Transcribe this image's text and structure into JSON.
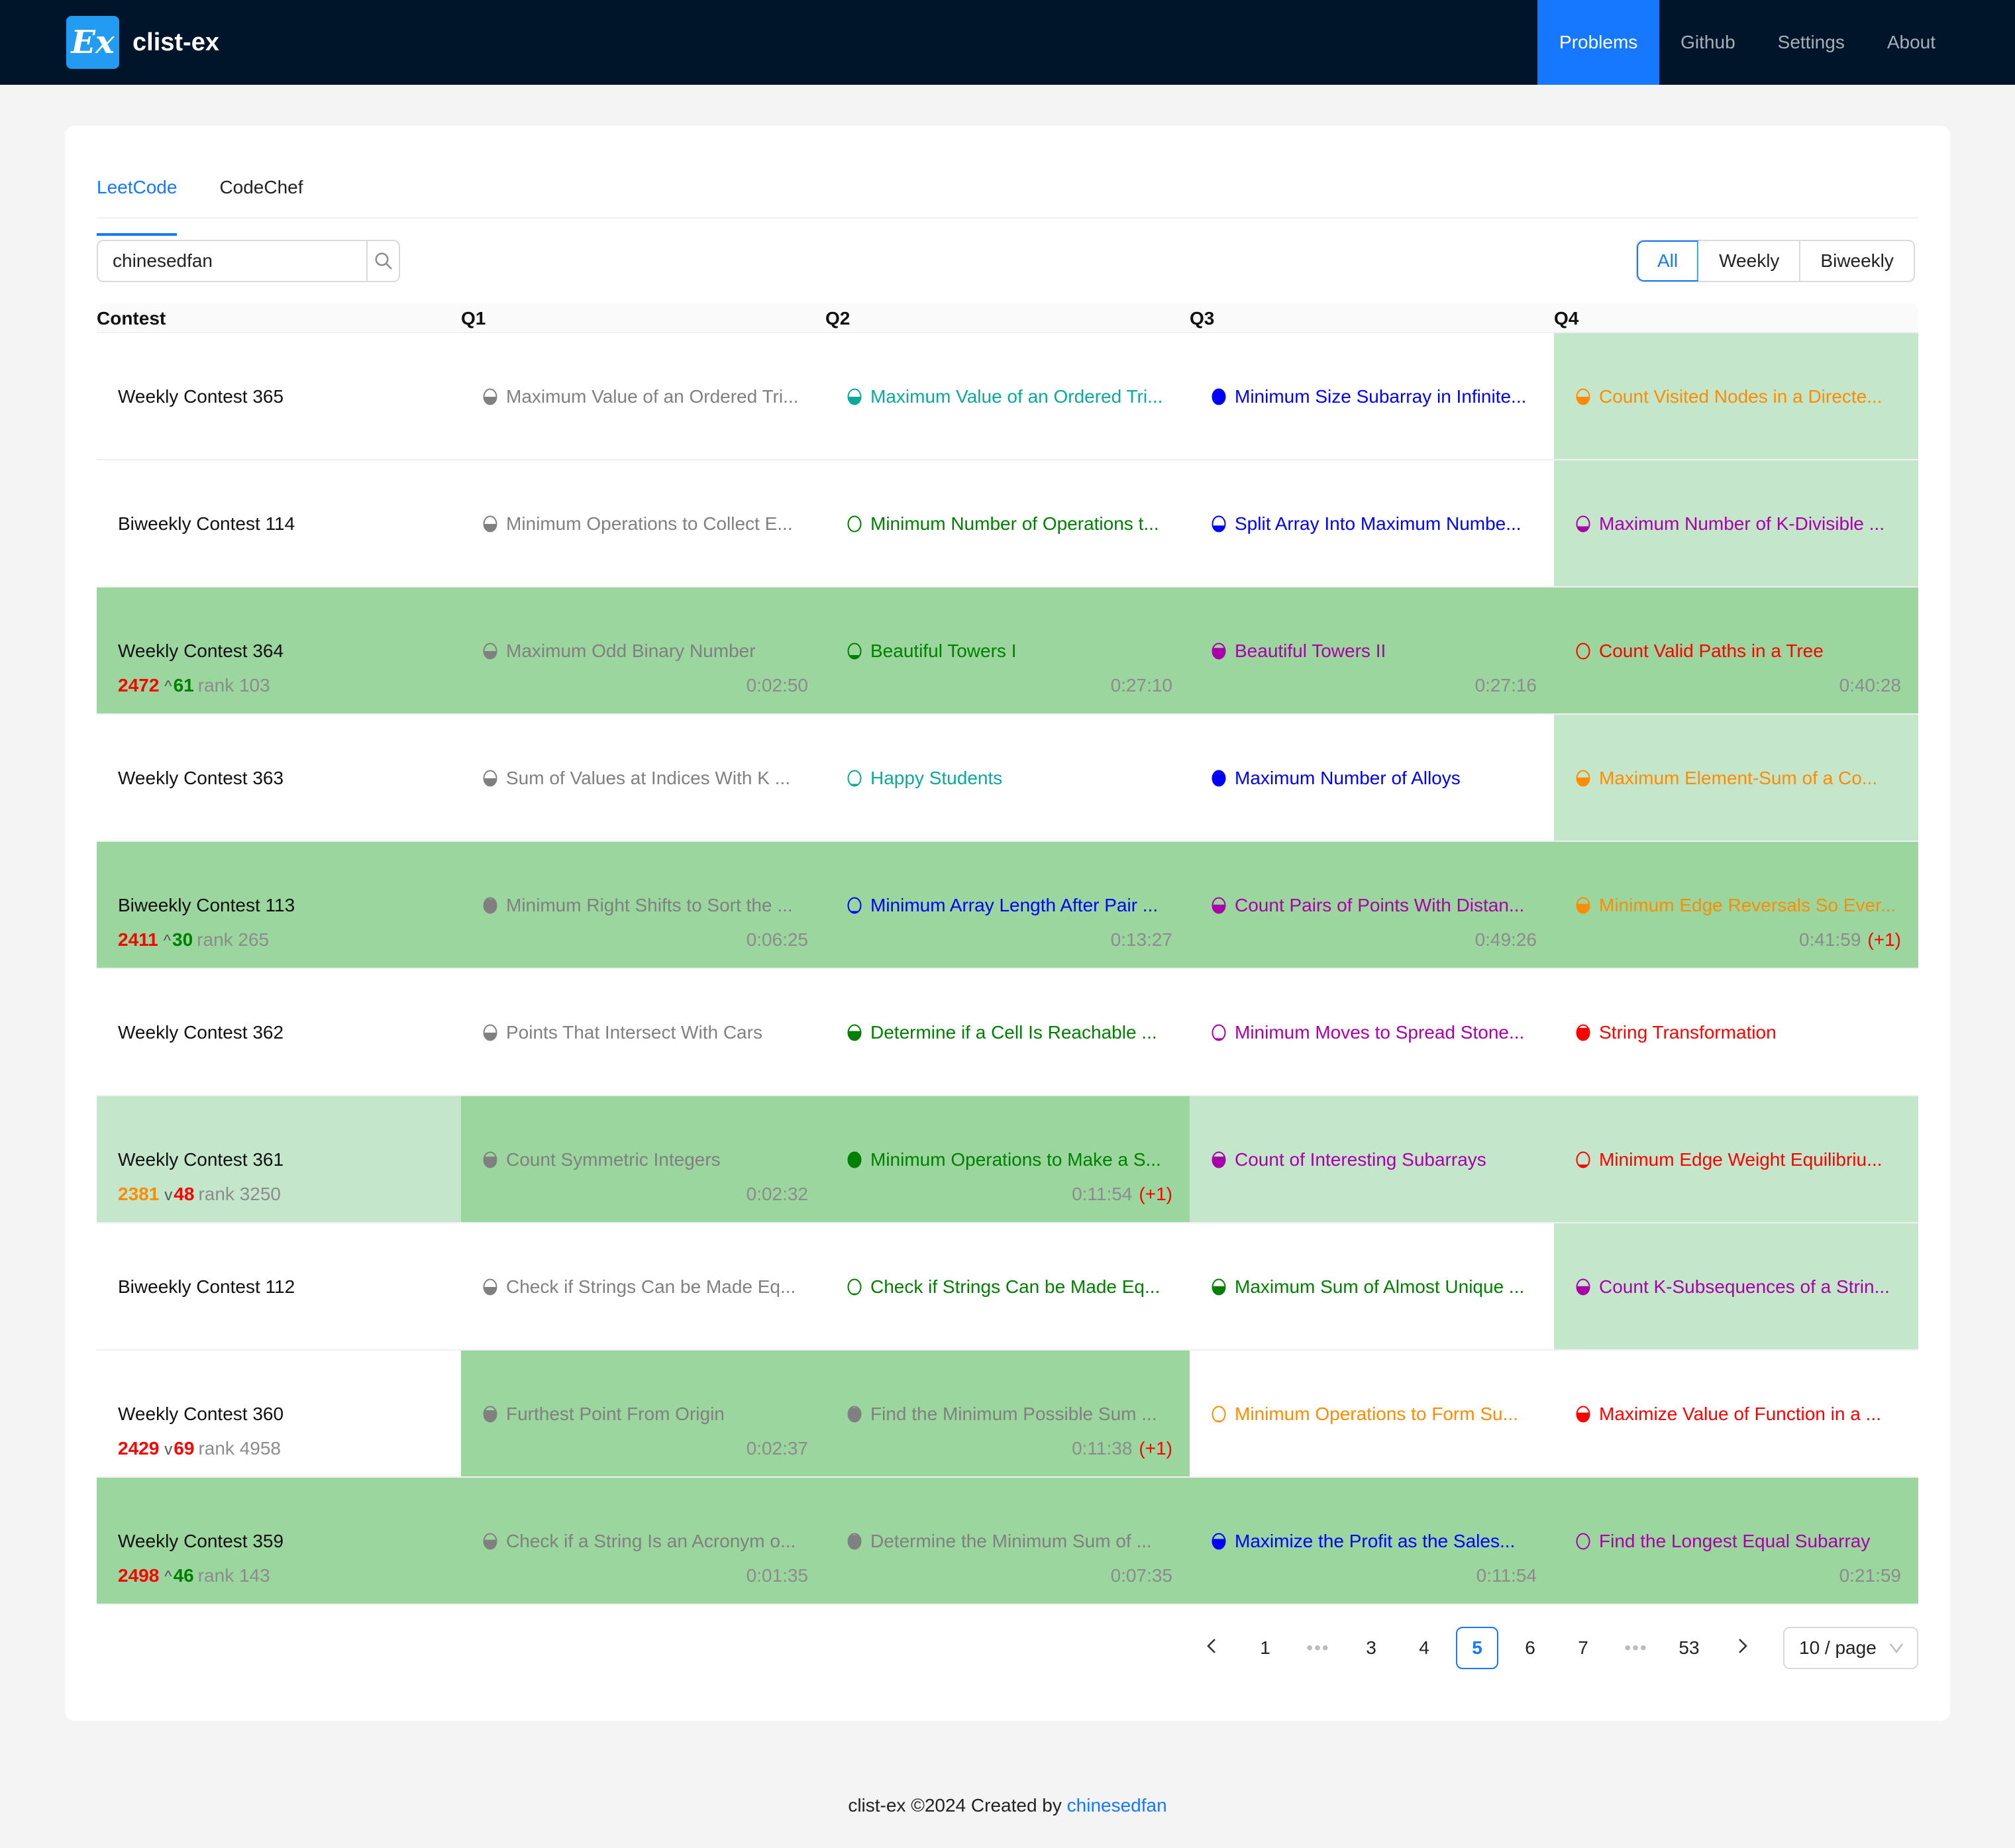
{
  "app": {
    "logo_text": "Ex",
    "brand": "clist-ex",
    "nav": [
      {
        "label": "Problems",
        "active": true
      },
      {
        "label": "Github",
        "active": false
      },
      {
        "label": "Settings",
        "active": false
      },
      {
        "label": "About",
        "active": false
      }
    ]
  },
  "tabs": [
    {
      "label": "LeetCode",
      "active": true
    },
    {
      "label": "CodeChef",
      "active": false
    }
  ],
  "search": {
    "value": "chinesedfan",
    "icon": "search-icon"
  },
  "filter": {
    "options": [
      "All",
      "Weekly",
      "Biweekly"
    ],
    "selected": "All"
  },
  "table": {
    "headers": [
      "Contest",
      "Q1",
      "Q2",
      "Q3",
      "Q4"
    ],
    "colors": {
      "row_highlight": "#9bd69e",
      "cell_solved_upsolve": "#c4e6cb",
      "gray": "#808080",
      "teal": "#0aa99a",
      "green": "#008000",
      "blue": "#0000ff",
      "purple": "#aa00aa",
      "orange": "#ff8c00",
      "red": "#ff0000"
    },
    "rows": [
      {
        "contest": "Weekly Contest 365",
        "row_bg": null,
        "problems": [
          {
            "title": "Maximum Value of an Ordered Tri...",
            "color": "gray",
            "fill": 0.5,
            "bg": null
          },
          {
            "title": "Maximum Value of an Ordered Tri...",
            "color": "teal",
            "fill": 0.5,
            "bg": null
          },
          {
            "title": "Minimum Size Subarray in Infinite...",
            "color": "blue",
            "fill": 0.95,
            "bg": null
          },
          {
            "title": "Count Visited Nodes in a Directe...",
            "color": "orange",
            "fill": 0.5,
            "bg": "light"
          }
        ]
      },
      {
        "contest": "Biweekly Contest 114",
        "row_bg": null,
        "problems": [
          {
            "title": "Minimum Operations to Collect E...",
            "color": "gray",
            "fill": 0.5,
            "bg": null
          },
          {
            "title": "Minimum Number of Operations t...",
            "color": "green",
            "fill": 0.05,
            "bg": null
          },
          {
            "title": "Split Array Into Maximum Numbe...",
            "color": "blue",
            "fill": 0.4,
            "bg": null
          },
          {
            "title": "Maximum Number of K-Divisible ...",
            "color": "purple",
            "fill": 0.35,
            "bg": "light"
          }
        ]
      },
      {
        "contest": "Weekly Contest 364",
        "row_bg": "dark",
        "rating": {
          "value": "2472",
          "color": "red",
          "direction": "up",
          "delta": "61",
          "delta_color": "green",
          "rank": "rank 103"
        },
        "problems": [
          {
            "title": "Maximum Odd Binary Number",
            "color": "gray",
            "fill": 0.5,
            "time": "0:02:50"
          },
          {
            "title": "Beautiful Towers I",
            "color": "green",
            "fill": 0.25,
            "time": "0:27:10"
          },
          {
            "title": "Beautiful Towers II",
            "color": "purple",
            "fill": 0.7,
            "time": "0:27:16"
          },
          {
            "title": "Count Valid Paths in a Tree",
            "color": "red",
            "fill": 0.05,
            "time": "0:40:28"
          }
        ]
      },
      {
        "contest": "Weekly Contest 363",
        "row_bg": null,
        "problems": [
          {
            "title": "Sum of Values at Indices With K ...",
            "color": "gray",
            "fill": 0.5,
            "bg": null
          },
          {
            "title": "Happy Students",
            "color": "teal",
            "fill": 0.15,
            "bg": null
          },
          {
            "title": "Maximum Number of Alloys",
            "color": "blue",
            "fill": 0.95,
            "bg": null
          },
          {
            "title": "Maximum Element-Sum of a Co...",
            "color": "orange",
            "fill": 0.55,
            "bg": "light"
          }
        ]
      },
      {
        "contest": "Biweekly Contest 113",
        "row_bg": "dark",
        "rating": {
          "value": "2411",
          "color": "red",
          "direction": "up",
          "delta": "30",
          "delta_color": "green",
          "rank": "rank 265"
        },
        "problems": [
          {
            "title": "Minimum Right Shifts to Sort the ...",
            "color": "gray",
            "fill": 0.9,
            "time": "0:06:25"
          },
          {
            "title": "Minimum Array Length After Pair ...",
            "color": "blue",
            "fill": 0.15,
            "time": "0:13:27"
          },
          {
            "title": "Count Pairs of Points With Distan...",
            "color": "purple",
            "fill": 0.55,
            "time": "0:49:26"
          },
          {
            "title": "Minimum Edge Reversals So Ever...",
            "color": "orange",
            "fill": 0.6,
            "time": "0:41:59",
            "penalty": "(+1)"
          }
        ]
      },
      {
        "contest": "Weekly Contest 362",
        "row_bg": null,
        "problems": [
          {
            "title": "Points That Intersect With Cars",
            "color": "gray",
            "fill": 0.5,
            "bg": null
          },
          {
            "title": "Determine if a Cell Is Reachable ...",
            "color": "green",
            "fill": 0.6,
            "bg": null
          },
          {
            "title": "Minimum Moves to Spread Stone...",
            "color": "purple",
            "fill": 0.15,
            "bg": null
          },
          {
            "title": "String Transformation",
            "color": "red",
            "fill": 0.8,
            "bg": null
          }
        ]
      },
      {
        "contest": "Weekly Contest 361",
        "row_bg": null,
        "contest_bg": "light",
        "rating": {
          "value": "2381",
          "color": "orange",
          "direction": "down",
          "delta": "48",
          "delta_color": "red",
          "rank": "rank 3250"
        },
        "problems": [
          {
            "title": "Count Symmetric Integers",
            "color": "gray",
            "fill": 0.7,
            "bg": "dark",
            "time": "0:02:32"
          },
          {
            "title": "Minimum Operations to Make a S...",
            "color": "green",
            "fill": 0.95,
            "bg": "dark",
            "time": "0:11:54",
            "penalty": "(+1)"
          },
          {
            "title": "Count of Interesting Subarrays",
            "color": "purple",
            "fill": 0.7,
            "bg": "light"
          },
          {
            "title": "Minimum Edge Weight Equilibriu...",
            "color": "red",
            "fill": 0.2,
            "bg": "light"
          }
        ]
      },
      {
        "contest": "Biweekly Contest 112",
        "row_bg": null,
        "problems": [
          {
            "title": "Check if Strings Can be Made Eq...",
            "color": "gray",
            "fill": 0.5,
            "bg": null
          },
          {
            "title": "Check if Strings Can be Made Eq...",
            "color": "green",
            "fill": 0.1,
            "bg": null
          },
          {
            "title": "Maximum Sum of Almost Unique ...",
            "color": "green",
            "fill": 0.55,
            "bg": null
          },
          {
            "title": "Count K-Subsequences of a Strin...",
            "color": "purple",
            "fill": 0.55,
            "bg": "light"
          }
        ]
      },
      {
        "contest": "Weekly Contest 360",
        "row_bg": null,
        "rating": {
          "value": "2429",
          "color": "red",
          "direction": "down",
          "delta": "69",
          "delta_color": "red",
          "rank": "rank 4958"
        },
        "problems": [
          {
            "title": "Furthest Point From Origin",
            "color": "gray",
            "fill": 0.75,
            "bg": "dark",
            "time": "0:02:37"
          },
          {
            "title": "Find the Minimum Possible Sum ...",
            "color": "gray",
            "fill": 0.9,
            "bg": "dark",
            "time": "0:11:38",
            "penalty": "(+1)"
          },
          {
            "title": "Minimum Operations to Form Su...",
            "color": "orange",
            "fill": 0.1,
            "bg": null
          },
          {
            "title": "Maximize Value of Function in a ...",
            "color": "red",
            "fill": 0.6,
            "bg": null
          }
        ]
      },
      {
        "contest": "Weekly Contest 359",
        "row_bg": "dark",
        "rating": {
          "value": "2498",
          "color": "red",
          "direction": "up",
          "delta": "46",
          "delta_color": "green",
          "rank": "rank 143"
        },
        "problems": [
          {
            "title": "Check if a String Is an Acronym o...",
            "color": "gray",
            "fill": 0.6,
            "time": "0:01:35"
          },
          {
            "title": "Determine the Minimum Sum of ...",
            "color": "gray",
            "fill": 0.9,
            "time": "0:07:35"
          },
          {
            "title": "Maximize the Profit as the Sales...",
            "color": "blue",
            "fill": 0.65,
            "time": "0:11:54"
          },
          {
            "title": "Find the Longest Equal Subarray",
            "color": "purple",
            "fill": 0.05,
            "time": "0:21:59"
          }
        ]
      }
    ]
  },
  "pagination": {
    "prev_icon": "chevron-left-icon",
    "items": [
      "1",
      "•••",
      "3",
      "4",
      "5",
      "6",
      "7",
      "•••",
      "53"
    ],
    "current": "5",
    "next_icon": "chevron-right-icon",
    "page_size": "10 / page"
  },
  "footer": {
    "text": "clist-ex ©2024 Created by ",
    "link": "chinesedfan"
  }
}
